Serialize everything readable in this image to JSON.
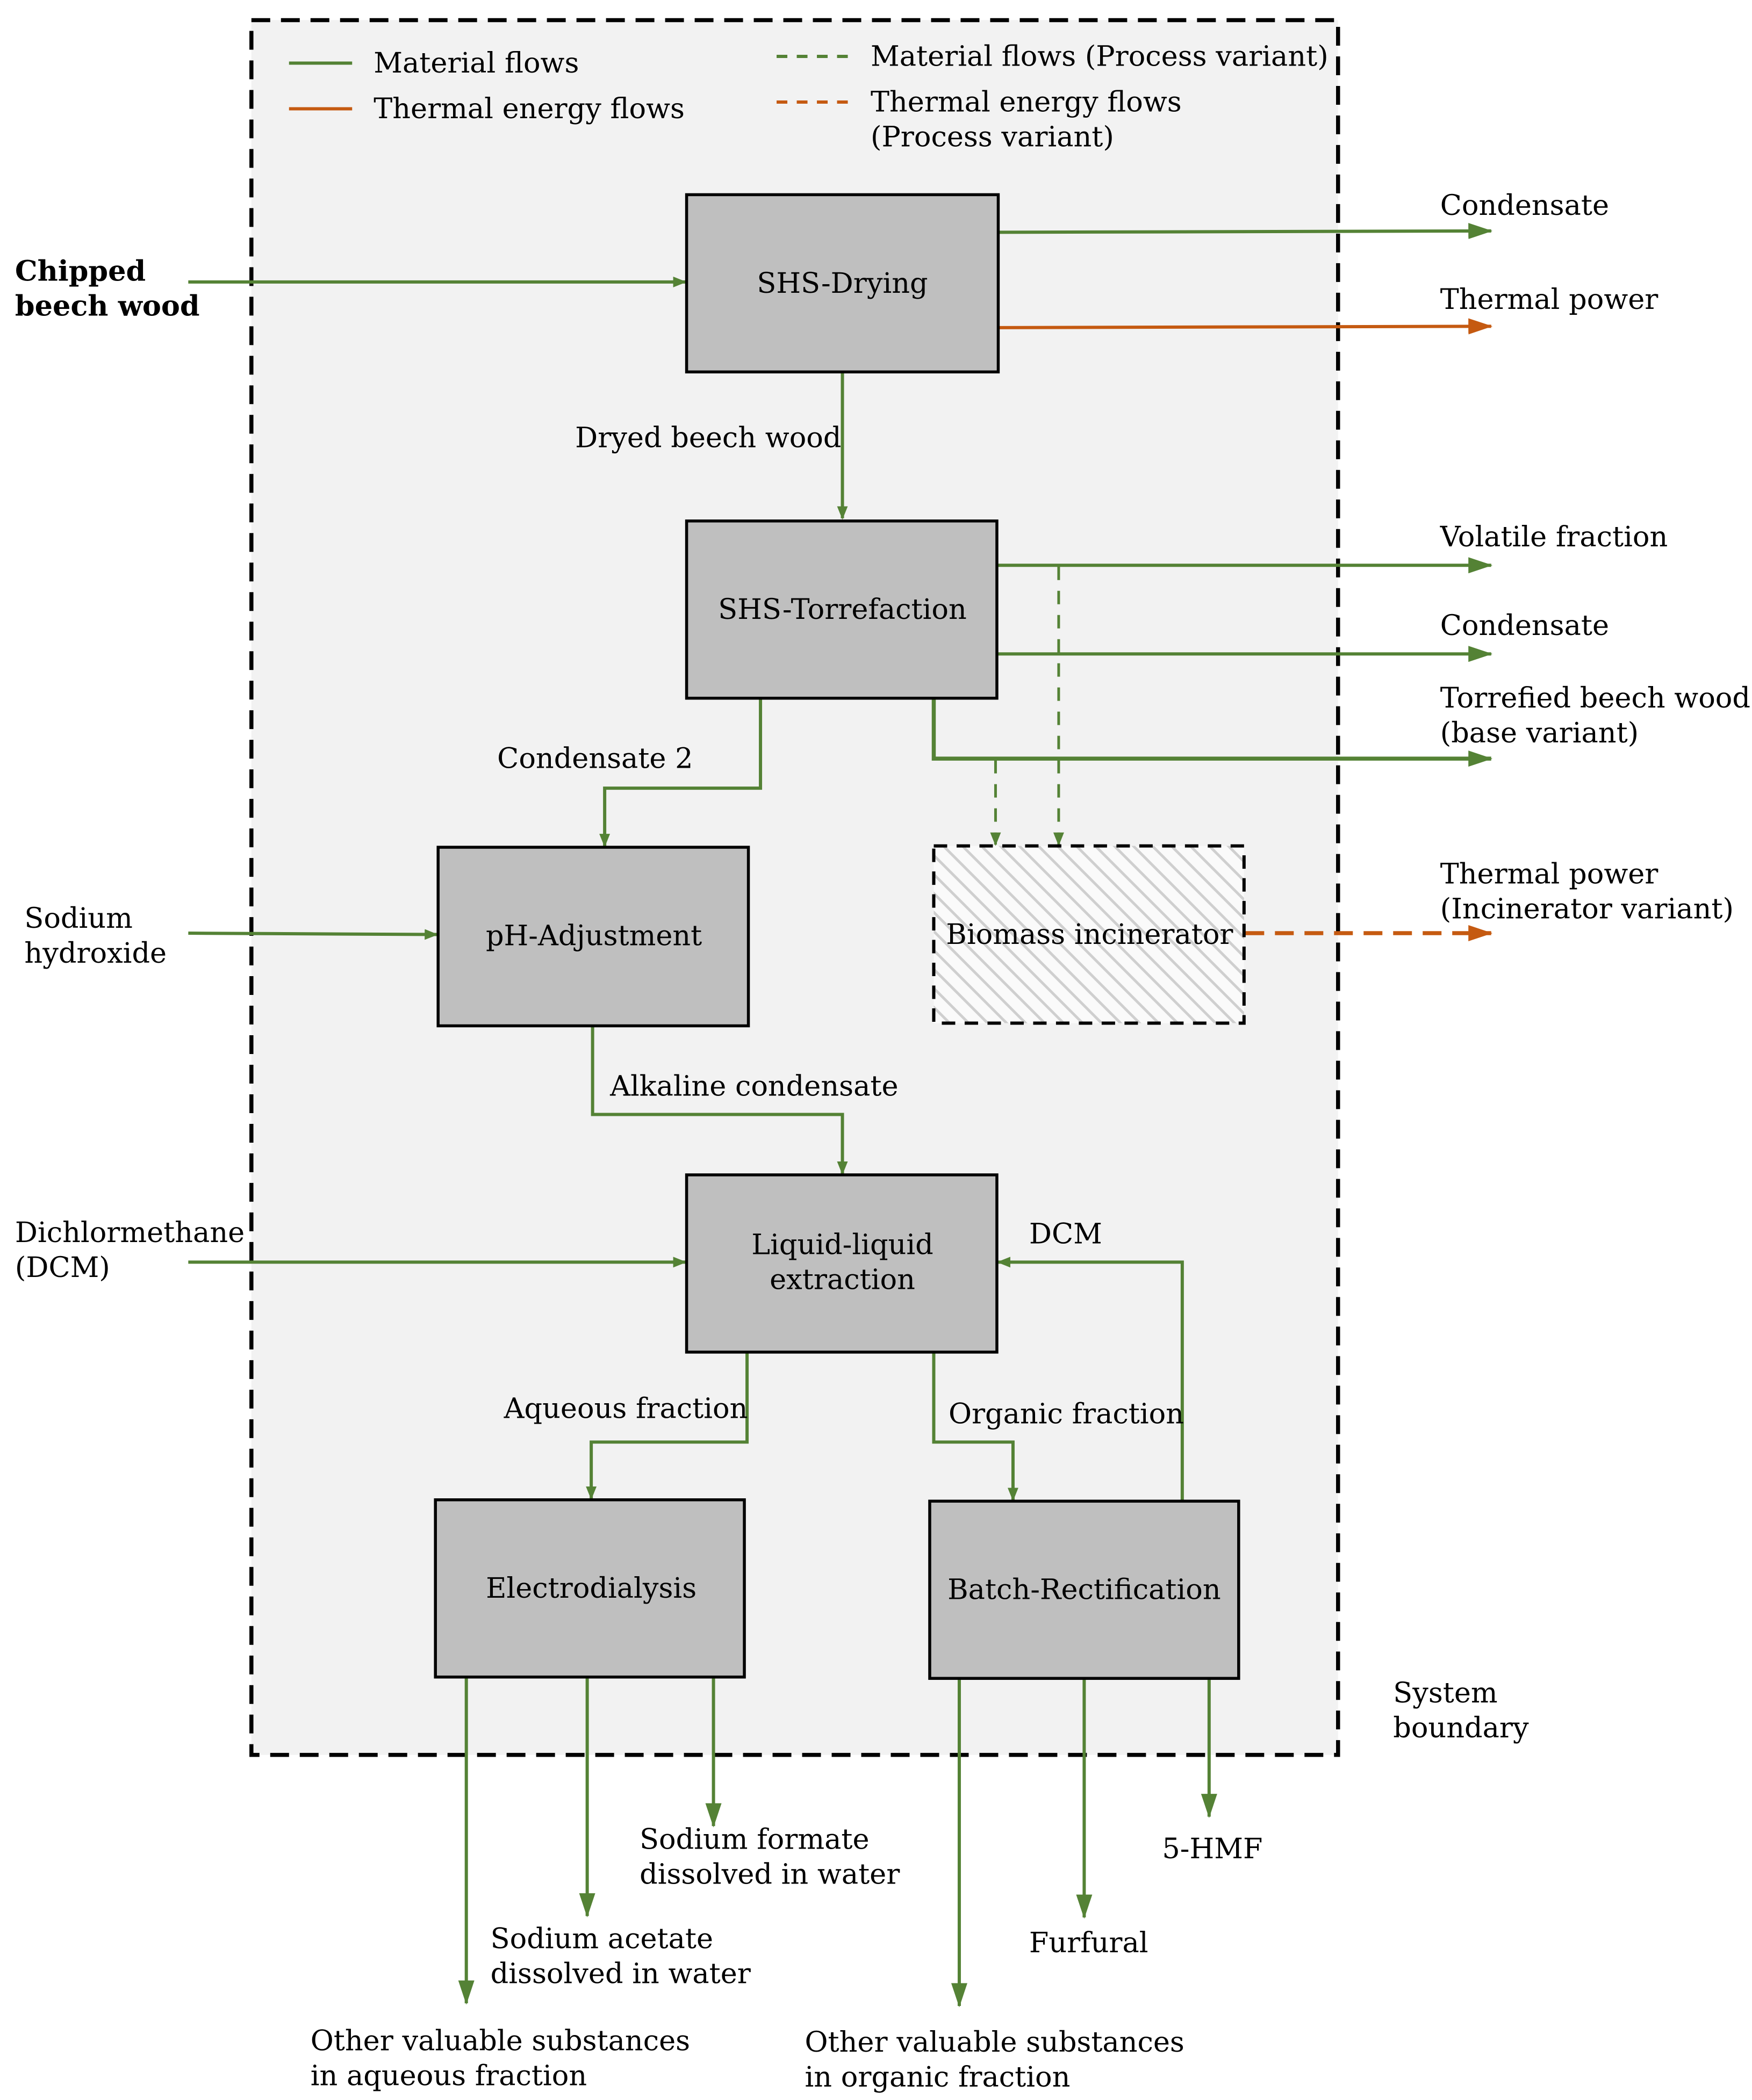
{
  "colors": {
    "material": "#548235",
    "thermal": "#c55a11",
    "box_fill": "#bfbfbf",
    "boundary_fill": "#f2f2f2"
  },
  "legend": [
    {
      "label": "Material flows",
      "style": "solid",
      "color": "#548235"
    },
    {
      "label": "Thermal energy flows",
      "style": "solid",
      "color": "#c55a11"
    },
    {
      "label": "Material flows (Process variant)",
      "style": "dashed",
      "color": "#548235"
    },
    {
      "label_lines": [
        "Thermal energy flows",
        "(Process variant)"
      ],
      "style": "dashed",
      "color": "#c55a11"
    }
  ],
  "boundary_label": [
    "System",
    "boundary"
  ],
  "processes": {
    "drying": "SHS-Drying",
    "torrefaction": "SHS-Torrefaction",
    "ph": "pH-Adjustment",
    "incinerator": "Biomass incinerator",
    "lle": [
      "Liquid-liquid",
      "extraction"
    ],
    "electrodialysis": "Electrodialysis",
    "rectification": "Batch-Rectification"
  },
  "inputs": {
    "wood": [
      "Chipped",
      "beech wood"
    ],
    "naoh": [
      "Sodium",
      "hydroxide"
    ],
    "dcm": [
      "Dichlormethane",
      "(DCM)"
    ]
  },
  "internal_flows": {
    "dried_wood": "Dryed beech wood",
    "condensate2": "Condensate 2",
    "alkaline": "Alkaline condensate",
    "aqueous": "Aqueous fraction",
    "organic": "Organic fraction",
    "dcm_recycle": "DCM"
  },
  "outputs": {
    "drying_condensate": "Condensate",
    "drying_thermal": "Thermal power",
    "volatile": "Volatile fraction",
    "torr_condensate": "Condensate",
    "torrefied": [
      "Torrefied beech wood",
      "(base variant)"
    ],
    "incinerator_power": [
      "Thermal power",
      "(Incinerator variant)"
    ],
    "formate": [
      "Sodium formate",
      "dissolved in water"
    ],
    "acetate": [
      "Sodium acetate",
      "dissolved in water"
    ],
    "other_aqueous": [
      "Other valuable substances",
      "in aqueous fraction"
    ],
    "furfural": "Furfural",
    "hmf": "5-HMF",
    "other_organic": [
      "Other valuable substances",
      "in organic fraction"
    ]
  }
}
